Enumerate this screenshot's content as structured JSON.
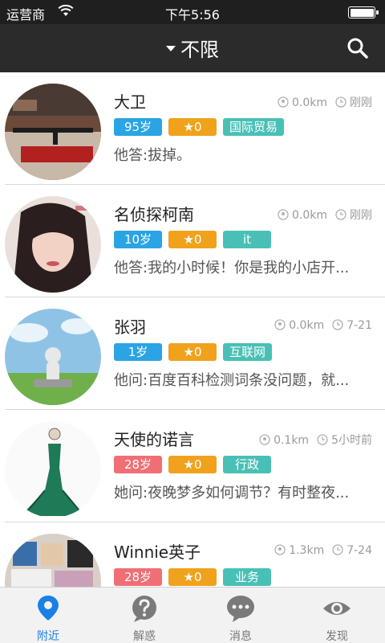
{
  "status_bar": {
    "carrier": "运营商",
    "time": "下午5:56"
  },
  "header": {
    "filter_label": "不限"
  },
  "users": [
    {
      "name": "大卫",
      "distance": "0.0km",
      "time": "刚刚",
      "age": "95岁",
      "age_color": "#2aa4e4",
      "stars": "★0",
      "occupation": "国际贸易",
      "qa": "他答:拔掉。"
    },
    {
      "name": "名侦探柯南",
      "distance": "0.0km",
      "time": "刚刚",
      "age": "10岁",
      "age_color": "#2aa4e4",
      "stars": "★0",
      "occupation": "it",
      "qa": "他答:我的小时候！你是我的小店开..."
    },
    {
      "name": "张羽",
      "distance": "0.0km",
      "time": "7-21",
      "age": "1岁",
      "age_color": "#2aa4e4",
      "stars": "★0",
      "occupation": "互联网",
      "qa": "他问:百度百科检测词条没问题，就..."
    },
    {
      "name": "天使的诺言",
      "distance": "0.1km",
      "time": "5小时前",
      "age": "28岁",
      "age_color": "#ef6f74",
      "stars": "★0",
      "occupation": "行政",
      "qa": "她问:夜晚梦多如何调节？有时整夜..."
    },
    {
      "name": "Winnie英子",
      "distance": "1.3km",
      "time": "7-24",
      "age": "28岁",
      "age_color": "#ef6f74",
      "stars": "★0",
      "occupation": "业务",
      "qa": ""
    }
  ],
  "tabs": [
    {
      "label": "附近",
      "icon": "location-pin-icon",
      "active": true
    },
    {
      "label": "解惑",
      "icon": "question-bubble-icon",
      "active": false
    },
    {
      "label": "消息",
      "icon": "chat-bubble-icon",
      "active": false
    },
    {
      "label": "发现",
      "icon": "eye-icon",
      "active": false
    }
  ],
  "colors": {
    "accent": "#1a80e6",
    "header_bg": "#2b2b2b",
    "star_tag": "#f0a21c",
    "job_tag": "#49c0b6"
  }
}
